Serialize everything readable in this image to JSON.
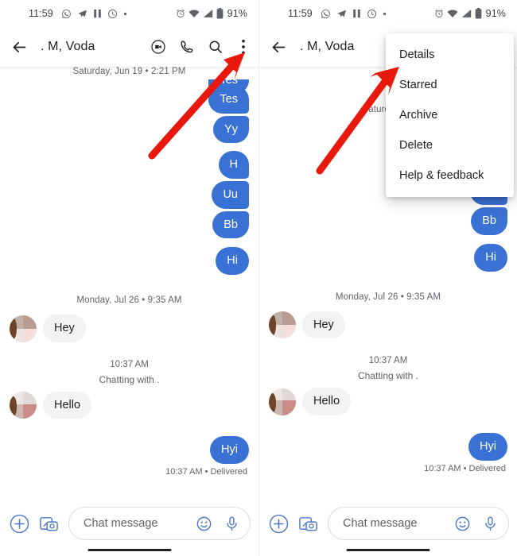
{
  "status_bar": {
    "time": "11:59",
    "battery_percent": "91%",
    "left_icons": [
      "whatsapp-icon",
      "telegram-icon",
      "pause-icon",
      "clock-icon",
      "dot-icon"
    ],
    "right_icons": [
      "alarm-icon",
      "wifi-icon",
      "signal-icon",
      "battery-icon"
    ]
  },
  "app_bar": {
    "back_label": "back-arrow",
    "title": ". M, Voda",
    "actions": [
      "video-call-icon",
      "phone-call-icon",
      "search-icon",
      "overflow-menu-icon"
    ]
  },
  "thread": {
    "clipped_bubble": "Tes",
    "day_stamp": "Saturday, Jun 19 • 2:21 PM",
    "day_stamp_truncated": "Saturday, Ju",
    "outgoing_group_1": [
      "Tes",
      "Yy"
    ],
    "outgoing_group_2": [
      "H",
      "Uu",
      "Bb"
    ],
    "outgoing_single": "Hi",
    "day_stamp_2": "Monday, Jul 26 • 9:35 AM",
    "incoming_1": "Hey",
    "time_stamp": "10:37 AM",
    "system_line": "Chatting with .",
    "incoming_2": "Hello",
    "outgoing_last": "Hyi",
    "delivered_status": "10:37 AM • Delivered"
  },
  "composer": {
    "add_label": "plus-icon",
    "gallery_label": "image-camera-icon",
    "placeholder": "Chat message",
    "emoji_label": "emoji-icon",
    "mic_label": "microphone-icon"
  },
  "overflow_menu": {
    "items": [
      {
        "label": "Details"
      },
      {
        "label": "Starred"
      },
      {
        "label": "Archive"
      },
      {
        "label": "Delete"
      },
      {
        "label": "Help & feedback"
      }
    ]
  },
  "annotations": {
    "left_arrow_target": "overflow-menu-icon",
    "right_arrow_target": "Details",
    "arrow_color": "#E8180C"
  },
  "colors": {
    "outgoing_bubble": "#3a71d4",
    "incoming_bubble": "#f1f3f4",
    "accent": "#1a73e8",
    "text_primary": "#202124",
    "text_secondary": "#5f6368"
  }
}
